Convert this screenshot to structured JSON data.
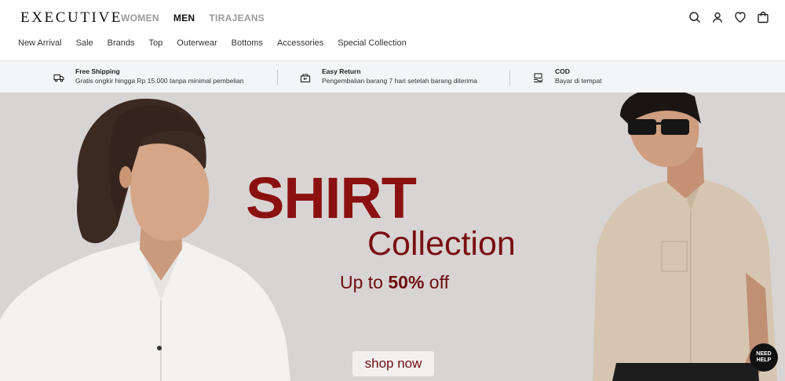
{
  "brand": {
    "logo": "EXECUTIVE"
  },
  "gender_tabs": [
    {
      "label": "WOMEN",
      "active": false
    },
    {
      "label": "MEN",
      "active": true
    },
    {
      "label": "TIRAJEANS",
      "active": false
    }
  ],
  "header_icons": [
    "search-icon",
    "user-icon",
    "heart-icon",
    "bag-icon"
  ],
  "nav": [
    "New Arrival",
    "Sale",
    "Brands",
    "Top",
    "Outerwear",
    "Bottoms",
    "Accessories",
    "Special Collection"
  ],
  "benefits": [
    {
      "icon": "truck-icon",
      "title": "Free Shipping",
      "desc": "Gratis ongkir hingga Rp 15.000 tanpa minimal pembelian"
    },
    {
      "icon": "return-box-icon",
      "title": "Easy Return",
      "desc": "Pengembalian barang 7 hari setelah barang diterima"
    },
    {
      "icon": "cash-icon",
      "title": "COD",
      "desc": "Bayar di tempat"
    }
  ],
  "hero": {
    "title": "SHIRT",
    "subtitle": "Collection",
    "promo_prefix": "Up to ",
    "promo_value": "50%",
    "promo_suffix": " off",
    "cta": "shop now"
  },
  "help_button": {
    "line1": "NEED",
    "line2": "HELP"
  },
  "colors": {
    "accent": "#8b1111",
    "hero_bg": "#d8d4d3",
    "benefit_bg": "#f4f5f7"
  }
}
